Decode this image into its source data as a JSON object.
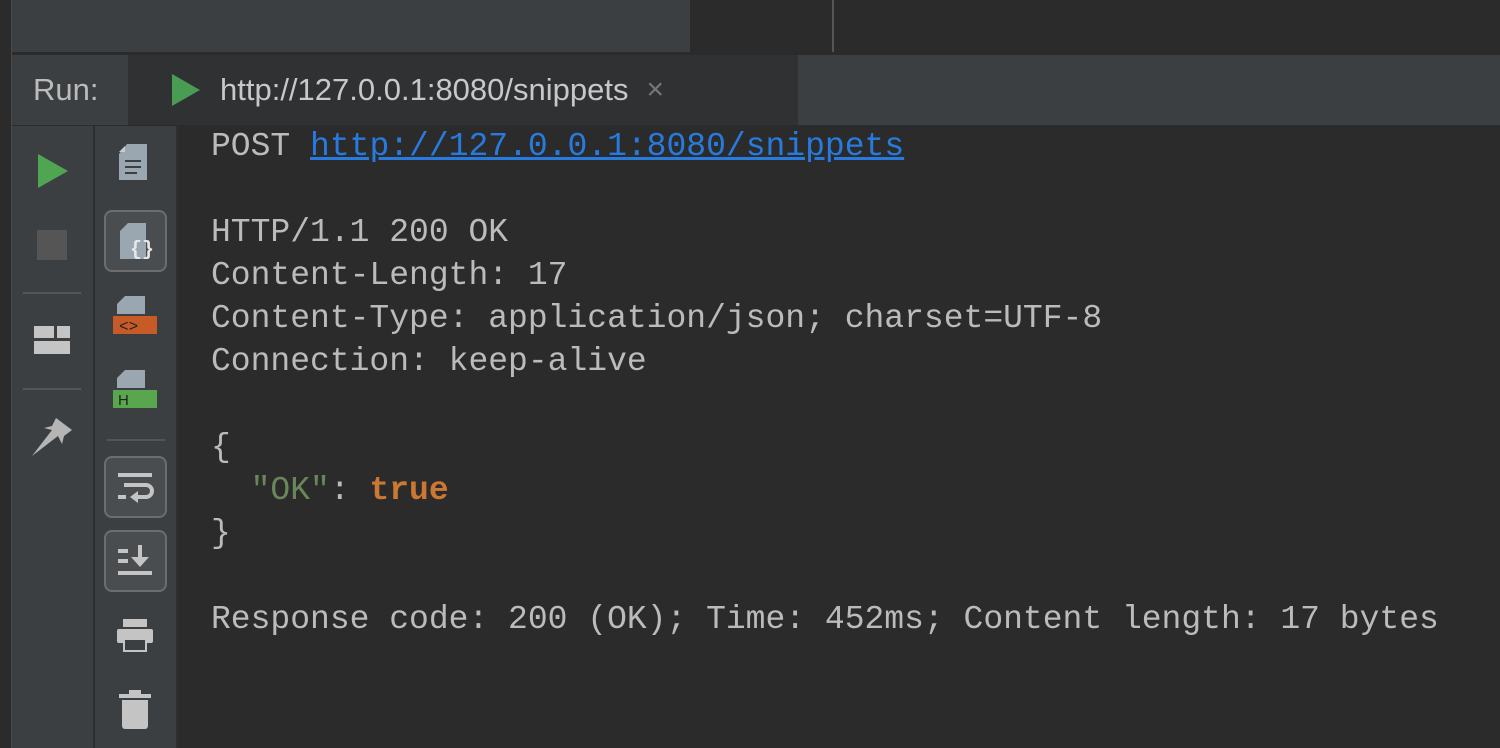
{
  "run_bar": {
    "label": "Run:",
    "tab_title": "http://127.0.0.1:8080/snippets",
    "close": "×"
  },
  "toolbar_left": [
    "run-icon",
    "stop-icon",
    "layout-icon",
    "pin-icon"
  ],
  "toolbar_right": [
    "text-view-icon",
    "json-view-icon",
    "html-view-icon",
    "headers-view-icon",
    "soft-wrap-icon",
    "scroll-to-end-icon",
    "print-icon",
    "delete-icon"
  ],
  "colors": {
    "accent_green": "#499c54",
    "link": "#287bde",
    "string": "#6a8759",
    "keyword": "#cc7832"
  },
  "console": {
    "method": "POST",
    "url": "http://127.0.0.1:8080/snippets",
    "status_line": "HTTP/1.1 200 OK",
    "headers": [
      "Content-Length: 17",
      "Content-Type: application/json; charset=UTF-8",
      "Connection: keep-alive"
    ],
    "open_brace": "{",
    "json_key": "\"OK\"",
    "json_colon": ": ",
    "json_value": "true",
    "close_brace": "}",
    "summary": "Response code: 200 (OK); Time: 452ms; Content length: 17 bytes"
  }
}
